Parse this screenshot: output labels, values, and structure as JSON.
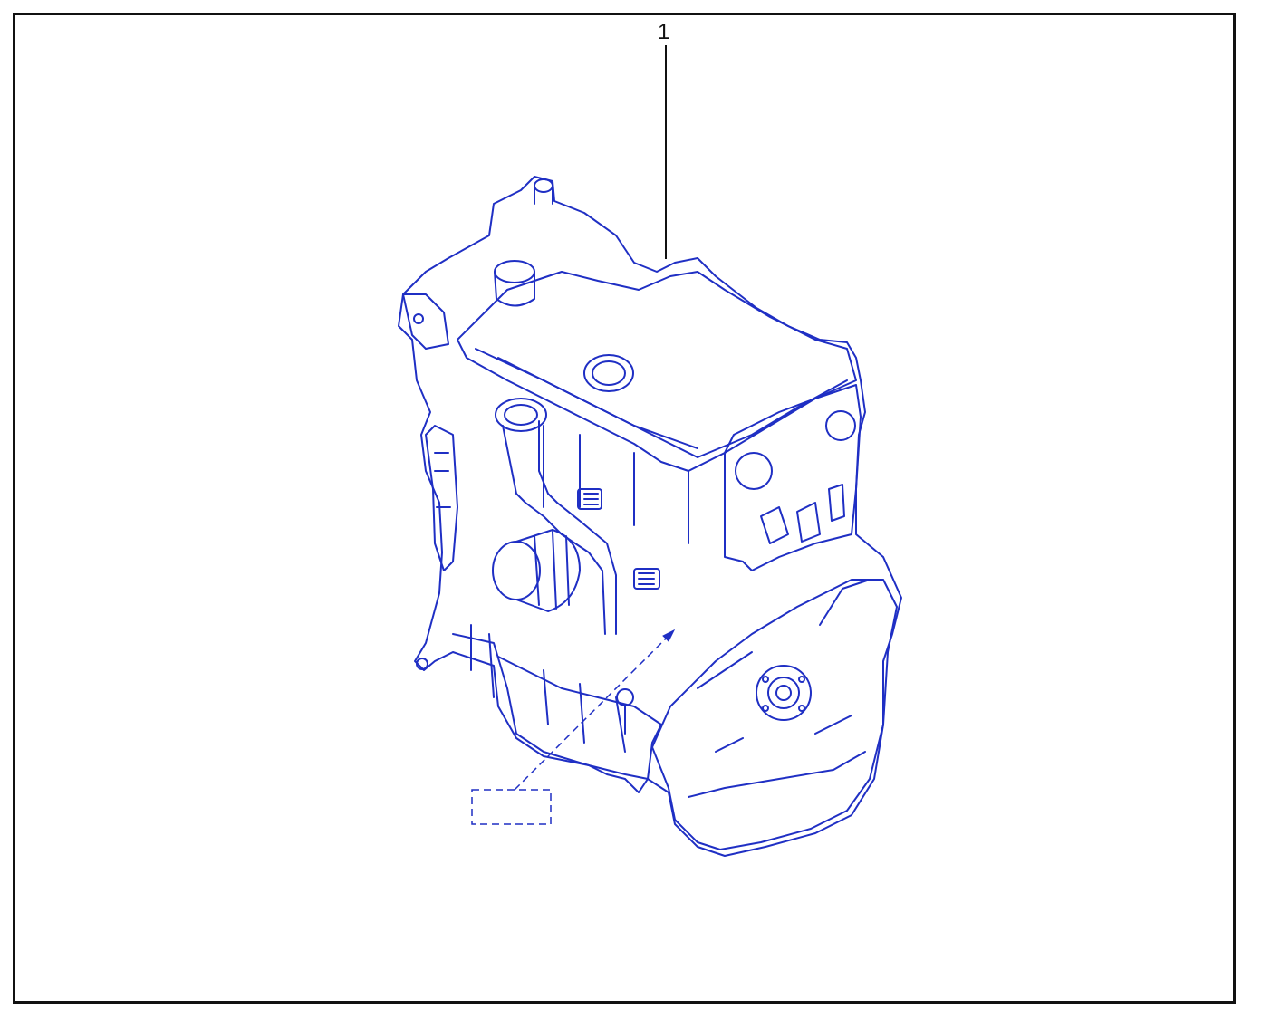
{
  "diagram": {
    "callouts": [
      {
        "number": "1"
      }
    ],
    "colors": {
      "line_art": "#1f2fc4",
      "frame": "#111111",
      "leader": "#111111"
    }
  }
}
